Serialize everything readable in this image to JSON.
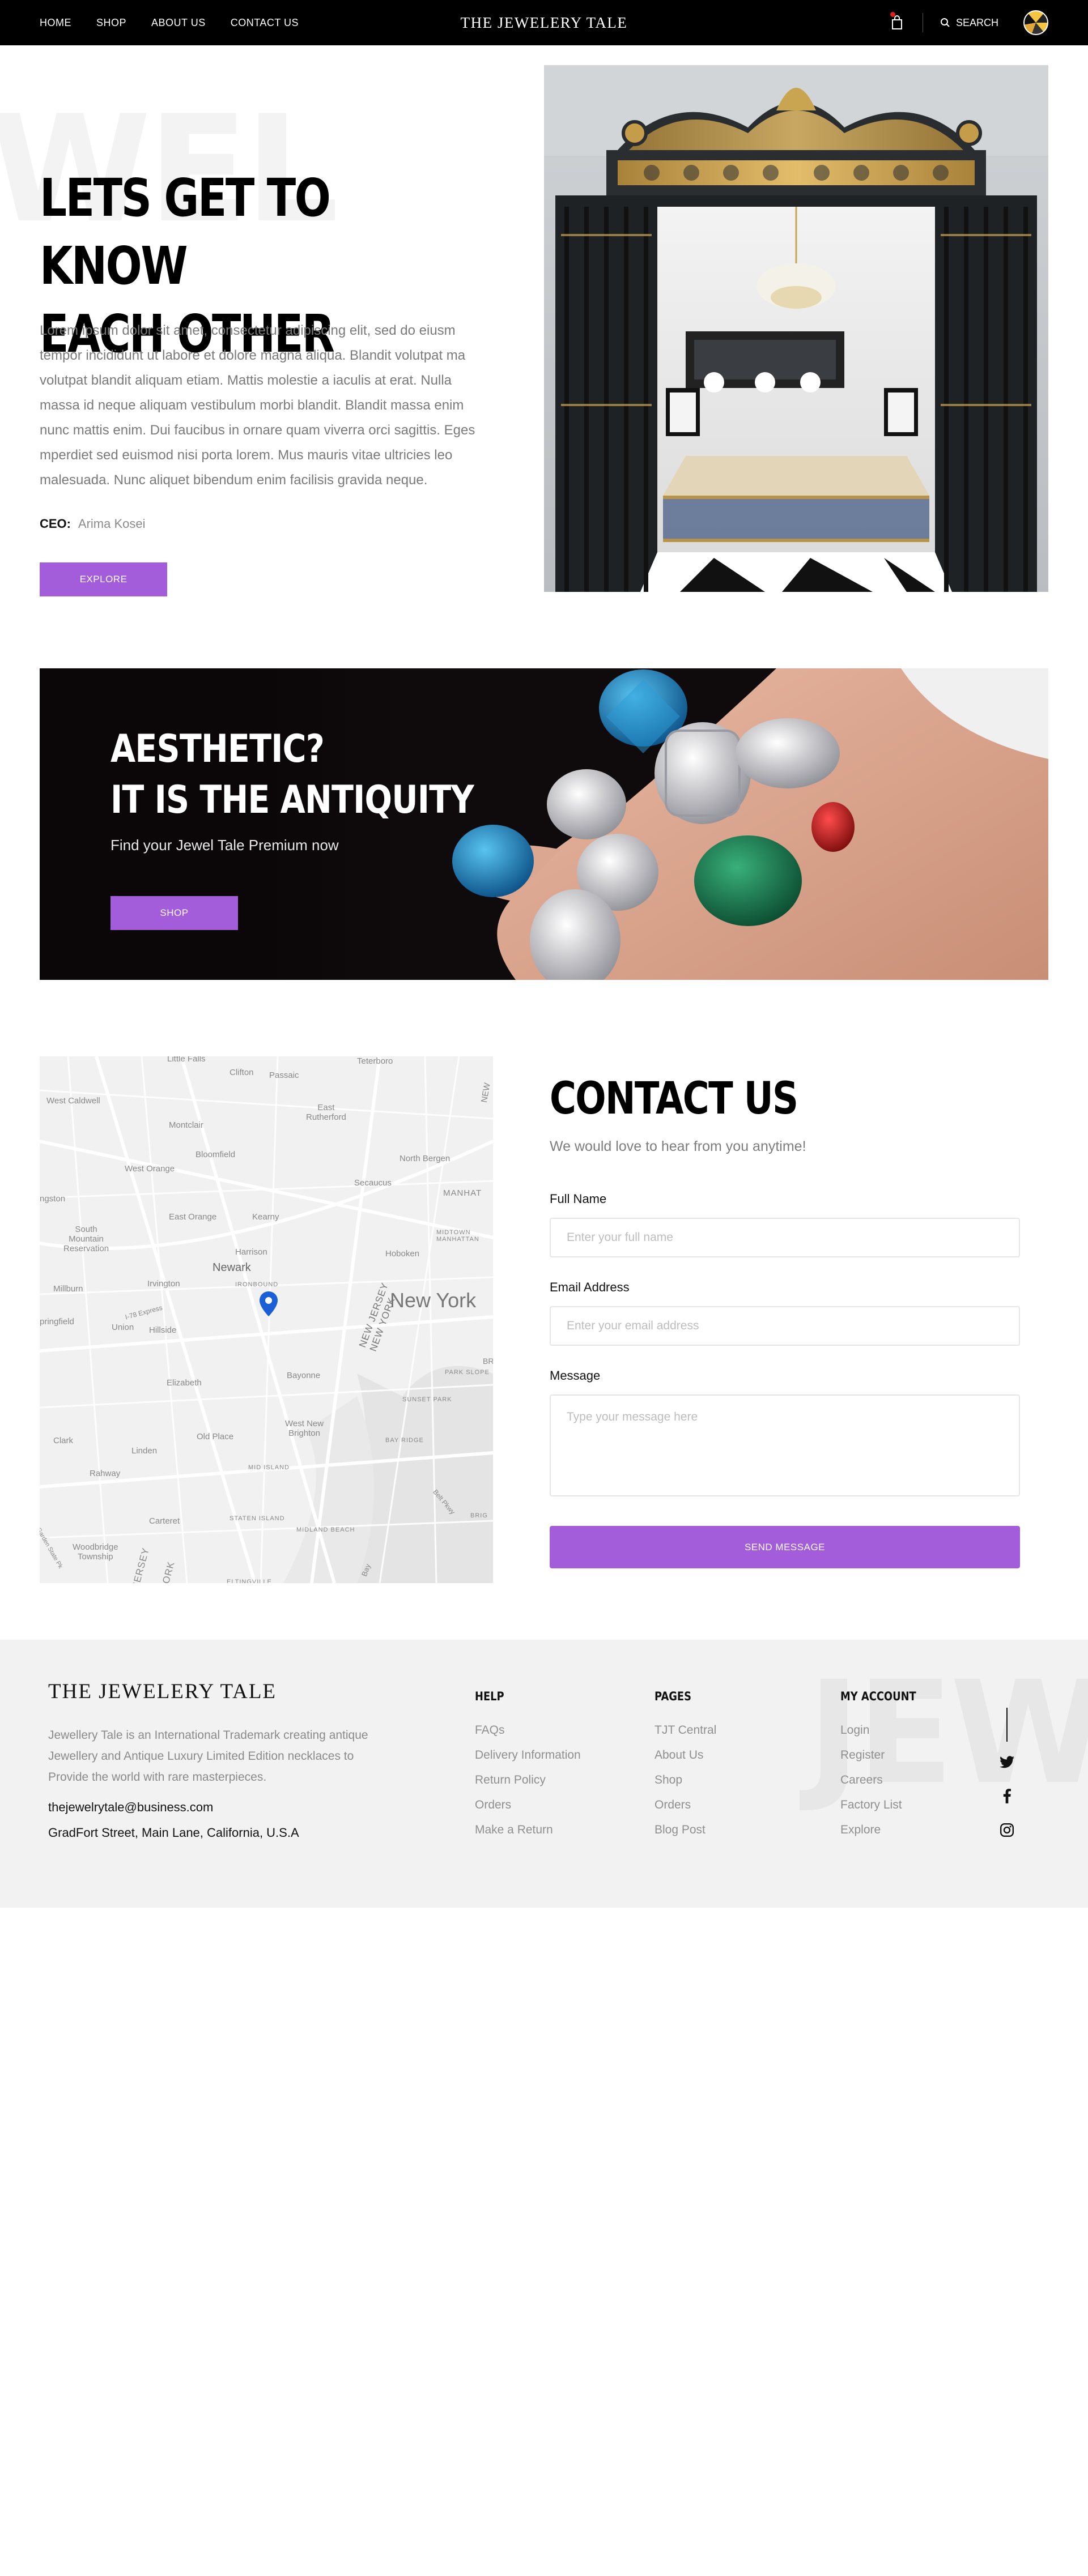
{
  "nav": {
    "links": [
      "HOME",
      "SHOP",
      "ABOUT US",
      "CONTACT US"
    ],
    "brand": "THE JEWELERY TALE",
    "search_label": "SEARCH"
  },
  "hero": {
    "bg_word": "WEL",
    "title_line1": "LETS GET TO KNOW",
    "title_line2": "EACH OTHER",
    "body": "Lorem ipsum dolor sit amet, consectetur adipiscing elit, sed do eiusm tempor incididunt ut labore et dolore magna aliqua. Blandit volutpat ma volutpat blandit aliquam etiam. Mattis molestie a iaculis at erat. Nulla massa id neque aliquam vestibulum morbi blandit. Blandit massa enim nunc mattis enim. Dui faucibus in ornare quam viverra orci sagittis. Eges mperdiet sed euismod nisi porta lorem. Mus mauris vitae ultricies leo malesuada. Nunc aliquet bibendum enim facilisis gravida neque.",
    "ceo_label": "CEO:",
    "ceo_name": "Arima Kosei",
    "explore_label": "EXPLORE"
  },
  "banner": {
    "title_line1": "AESTHETIC?",
    "title_line2": "IT IS THE ANTIQUITY",
    "subtitle": "Find your Jewel Tale Premium now",
    "shop_label": "SHOP"
  },
  "map": {
    "labels": {
      "little_falls": "Little Falls",
      "clifton": "Clifton",
      "passaic": "Passaic",
      "teterboro": "Teterboro",
      "west_caldwell": "West Caldwell",
      "east_rutherford": "East\nRutherford",
      "montclair": "Montclair",
      "bloomfield": "Bloomfield",
      "north_bergen": "North Bergen",
      "west_orange": "West Orange",
      "secaucus": "Secaucus",
      "manhattan": "MANHAT",
      "livingston": "ngston",
      "east_orange": "East Orange",
      "kearny": "Kearny",
      "south_mountain": "South\nMountain\nReservation",
      "midtown": "MIDTOWN\nMANHATTAN",
      "harrison": "Harrison",
      "hoboken": "Hoboken",
      "newark": "Newark",
      "ironbound": "IRONBOUND",
      "millburn": "Millburn",
      "irvington": "Irvington",
      "new_york": "New York",
      "springfield": "pringfield",
      "union": "Union",
      "hillside": "Hillside",
      "expressway": "I-78 Express",
      "nj_ny": "NEW JERSEY\nNEW YORK",
      "park_slope": "PARK SLOPE",
      "elizabeth": "Elizabeth",
      "bayonne": "Bayonne",
      "sunset_park": "SUNSET PARK",
      "clark": "Clark",
      "west_new_brighton": "West New\nBrighton",
      "old_place": "Old Place",
      "bay_ridge": "BAY RIDGE",
      "linden": "Linden",
      "rahway": "Rahway",
      "mid_island": "MID ISLAND",
      "carteret": "Carteret",
      "staten_island": "STATEN ISLAND",
      "midland_beach": "MIDLAND BEACH",
      "woodbridge": "Woodbridge\nTownship",
      "garden_state": "Garden State Pk",
      "jersey": "JERSEY",
      "york": "YORK",
      "belt_pkwy": "Belt Pkwy",
      "bay": "Bay",
      "brig": "BRIG",
      "br": "BR",
      "eltingville": "ELTINGVILLE",
      "new_edge": "NEW"
    }
  },
  "contact": {
    "title": "CONTACT US",
    "subtitle": "We would love to hear from you anytime!",
    "name_label": "Full Name",
    "name_placeholder": "Enter your full name",
    "email_label": "Email Address",
    "email_placeholder": "Enter your email address",
    "message_label": "Message",
    "message_placeholder": "Type your message here",
    "send_label": "SEND MESSAGE"
  },
  "footer": {
    "bg_word": "JEW",
    "logo": "THE JEWELERY TALE",
    "description": "Jewellery Tale is an International Trademark creating antique Jewellery and Antique Luxury Limited Edition necklaces to Provide the world with rare masterpieces.",
    "email": "thejewelrytale@business.com",
    "address": "GradFort Street, Main Lane, California, U.S.A",
    "columns": [
      {
        "heading": "HELP",
        "links": [
          "FAQs",
          "Delivery Information",
          "Return Policy",
          "Orders",
          "Make a Return"
        ]
      },
      {
        "heading": "PAGES",
        "links": [
          "TJT Central",
          "About Us",
          "Shop",
          "Orders",
          "Blog Post"
        ]
      },
      {
        "heading": "MY ACCOUNT",
        "links": [
          "Login",
          "Register",
          "Careers",
          "Factory List",
          "Explore"
        ]
      }
    ]
  },
  "colors": {
    "accent": "#a35ddb",
    "nav_bg": "#000000",
    "footer_bg": "#f2f2f2",
    "cart_badge": "#e02020",
    "map_pin": "#1b5fd6"
  },
  "icons": [
    "cart-icon",
    "search-icon",
    "map-pin-icon",
    "twitter-icon",
    "facebook-icon",
    "instagram-icon"
  ]
}
